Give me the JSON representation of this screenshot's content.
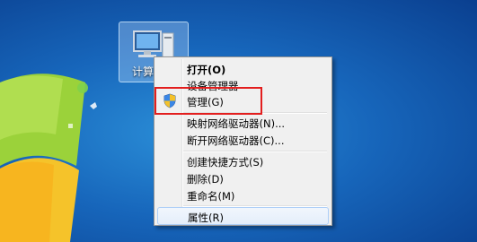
{
  "desktop": {
    "icon_label": "计算机"
  },
  "context_menu": {
    "items": [
      {
        "label": "打开(O)",
        "bold": true
      },
      {
        "label": "设备管理器"
      },
      {
        "label": "管理(G)",
        "icon": "shield-icon"
      },
      {
        "label": "映射网络驱动器(N)..."
      },
      {
        "label": "断开网络驱动器(C)..."
      },
      {
        "label": "创建快捷方式(S)"
      },
      {
        "label": "删除(D)"
      },
      {
        "label": "重命名(M)"
      },
      {
        "label": "属性(R)"
      }
    ]
  },
  "colors": {
    "highlight_border": "#e31e1e",
    "desktop_blue": "#1766bb"
  }
}
